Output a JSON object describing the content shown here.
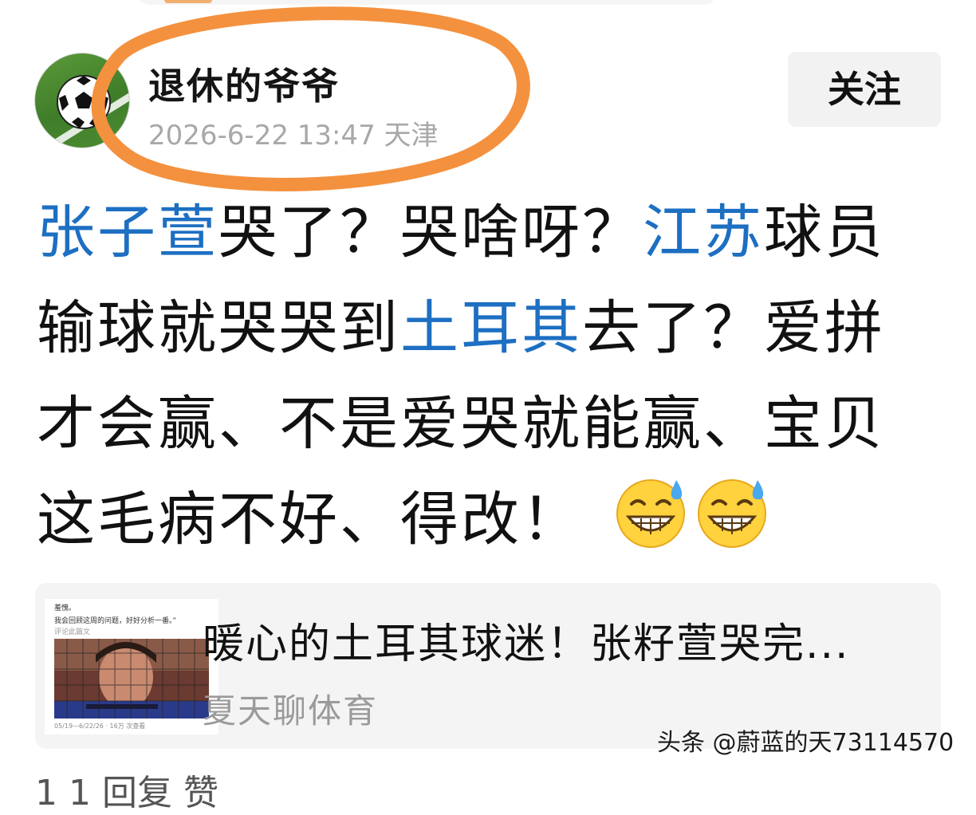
{
  "post": {
    "author": "退休的爷爷",
    "meta": "2026-6-22 13:47 天津",
    "follow_label": "关注",
    "body": {
      "line1": {
        "tag1": "张子萱",
        "text1": "哭了？哭啥呀？",
        "tag2": "江苏",
        "text2": "球员"
      },
      "line2": {
        "text1": "输球就哭哭到",
        "tag": "土耳其",
        "text2": "去了？爱拼"
      },
      "line3": "才会赢、不是爱哭就能赢、宝贝",
      "line4": "这毛病不好、得改！",
      "emojis": [
        "grin-sweat-emoji",
        "grin-sweat-emoji"
      ]
    }
  },
  "link_card": {
    "title": "暖心的土耳其球迷！张籽萱哭完...",
    "source": "夏天聊体育",
    "thumbnail": {
      "line1": "羞愧。",
      "line2": "我会回顾这周的问题，好好分析一番。”",
      "line3": "评论此篇文",
      "footer": "05/19—6/22/26 · 16万 次查看"
    }
  },
  "watermark": "头条 @蔚蓝的天73114570",
  "bottom_partial": "1 1 回复 赞",
  "colors": {
    "tag_blue": "#1d6fc2",
    "annotation_orange": "#f4913e",
    "meta_gray": "#a8a8a8",
    "button_bg": "#f2f2f2"
  }
}
